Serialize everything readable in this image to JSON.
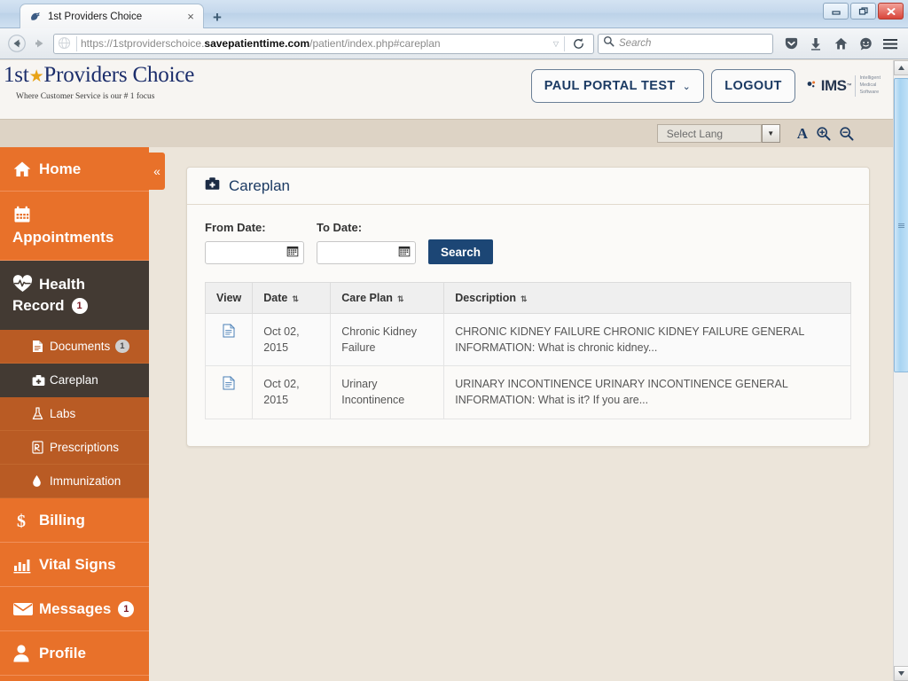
{
  "browser": {
    "tab": {
      "title": "1st Providers Choice",
      "favicon": "bird-favicon",
      "close_label": "×"
    },
    "new_tab_label": "+",
    "window_controls": [
      "minimize-button",
      "restore-button",
      "close-button"
    ],
    "nav": {
      "back": "back-arrow-icon",
      "forward": "forward-arrow-icon",
      "url_prefix": "https://1stproviderschoice.",
      "url_domain": "savepatienttime.com",
      "url_suffix": "/patient/index.php#careplan",
      "reload": "reload-icon",
      "search_placeholder": "Search",
      "toolbar_icons": [
        "pocket-icon",
        "downloads-icon",
        "home-icon",
        "chat-icon",
        "menu-icon"
      ]
    }
  },
  "header": {
    "logo_pre": "1st",
    "logo_star": "★",
    "logo_post": "Providers Choice",
    "tagline": "Where Customer Service is our # 1 focus",
    "user_button": "PAUL PORTAL TEST",
    "user_chevron": "⌄",
    "logout_button": "LOGOUT",
    "ims_text": "IMS",
    "ims_tm": "™",
    "ims_sub_1": "Intelligent",
    "ims_sub_2": "Medical",
    "ims_sub_3": "Software"
  },
  "lang_bar": {
    "select_value": "Select Lang",
    "font_normal": "A",
    "zoom_in": "zoom-in-icon",
    "zoom_out": "zoom-out-icon"
  },
  "sidebar": {
    "collapse_icon": "«",
    "items": [
      {
        "label": "Home",
        "icon": "home-icon",
        "state": "normal"
      },
      {
        "label": "Appointments",
        "icon": "calendar-icon",
        "state": "normal"
      },
      {
        "label": "Health Record",
        "icon": "heartbeat-icon",
        "state": "active",
        "badge": "1"
      },
      {
        "label": "Billing",
        "icon": "dollar-icon",
        "state": "normal"
      },
      {
        "label": "Vital Signs",
        "icon": "bar-chart-icon",
        "state": "normal"
      },
      {
        "label": "Messages",
        "icon": "envelope-icon",
        "state": "normal",
        "badge": "1"
      },
      {
        "label": "Profile",
        "icon": "user-icon",
        "state": "normal"
      }
    ],
    "sub_items": [
      {
        "label": "Documents",
        "icon": "document-icon",
        "badge": "1",
        "state": "normal"
      },
      {
        "label": "Careplan",
        "icon": "briefcase-medical-icon",
        "state": "active"
      },
      {
        "label": "Labs",
        "icon": "flask-icon",
        "state": "normal"
      },
      {
        "label": "Prescriptions",
        "icon": "prescription-icon",
        "state": "normal"
      },
      {
        "label": "Immunization",
        "icon": "droplet-icon",
        "state": "normal"
      }
    ]
  },
  "panel": {
    "icon": "briefcase-medical-icon",
    "title": "Careplan",
    "form": {
      "from_label": "From Date:",
      "to_label": "To Date:",
      "from_value": "",
      "to_value": "",
      "from_placeholder": "",
      "to_placeholder": "",
      "calendar_icon": "calendar-icon",
      "search_button": "Search"
    },
    "table": {
      "columns": [
        {
          "label": "View",
          "sortable": false
        },
        {
          "label": "Date",
          "sortable": true
        },
        {
          "label": "Care Plan",
          "sortable": true
        },
        {
          "label": "Description",
          "sortable": true
        }
      ],
      "sort_glyph": "⇅",
      "rows": [
        {
          "view_icon": "document-view-icon",
          "date": "Oct 02, 2015",
          "care_plan": "Chronic Kidney Failure",
          "description": "CHRONIC KIDNEY FAILURE CHRONIC KIDNEY FAILURE GENERAL INFORMATION: What is chronic kidney..."
        },
        {
          "view_icon": "document-view-icon",
          "date": "Oct 02, 2015",
          "care_plan": "Urinary Incontinence",
          "description": "URINARY INCONTINENCE URINARY INCONTINENCE GENERAL INFORMATION: What is it? If you are..."
        }
      ]
    }
  },
  "colors": {
    "sidebar_orange": "#e8712a",
    "sidebar_dark": "#433a33",
    "sidebar_suborange": "#b95b24",
    "accent_navy": "#1c4675",
    "page_bg": "#ece5da",
    "lang_bar": "#ddd3c5"
  }
}
